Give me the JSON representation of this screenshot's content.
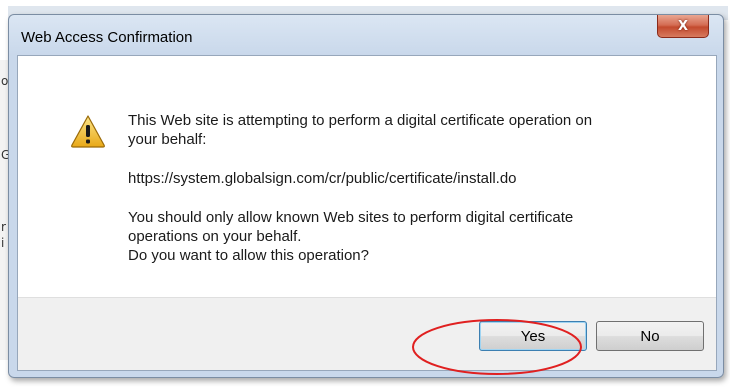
{
  "dialog": {
    "title": "Web Access Confirmation",
    "close_glyph": "X",
    "icon": "warning-icon",
    "message": {
      "line1": "This Web site is attempting to perform a digital certificate operation on",
      "line2": "your behalf:",
      "url": "https://system.globalsign.com/cr/public/certificate/install.do",
      "line3": "You should only allow known Web sites to perform digital certificate",
      "line4": "operations on your behalf.",
      "line5": "Do you want to allow this operation?"
    },
    "buttons": {
      "yes_label": "Yes",
      "no_label": "No"
    }
  },
  "background_fragments": [
    "o",
    "G",
    "r",
    "i"
  ],
  "colors": {
    "annotation_ellipse": "#e02020",
    "close_button": "#c34a2e",
    "warning_fill": "#f2c230"
  }
}
